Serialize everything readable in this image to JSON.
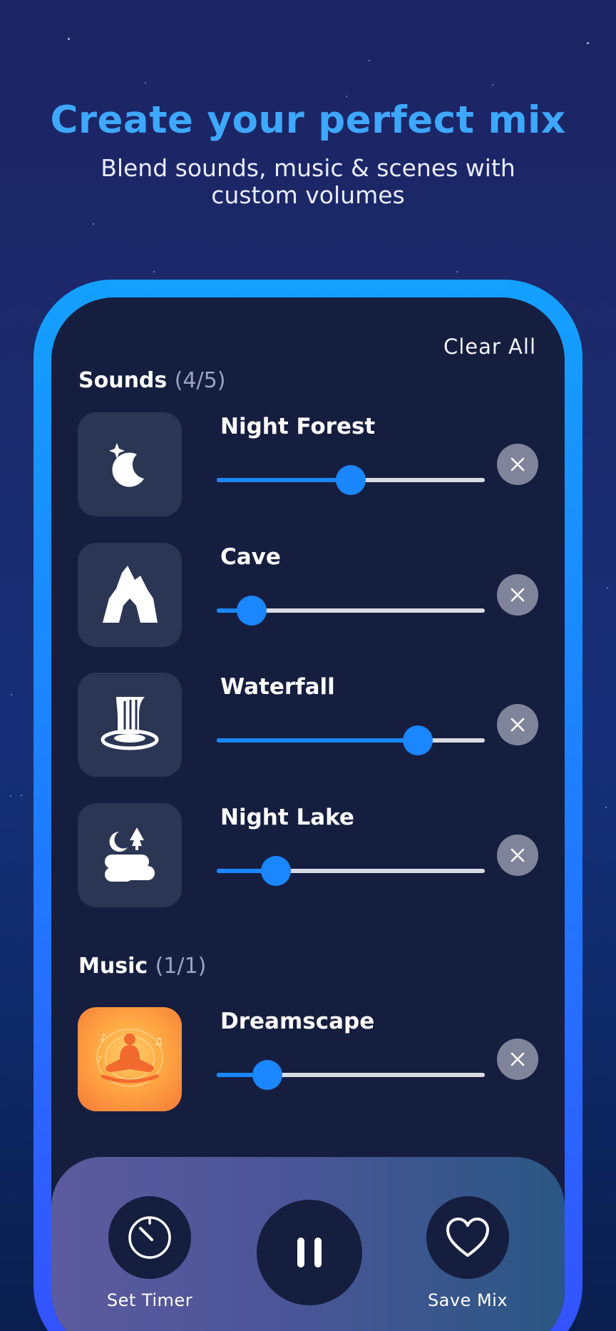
{
  "promo": {
    "headline": "Create your perfect mix",
    "subline": "Blend sounds, music & scenes with custom volumes"
  },
  "mixer": {
    "clear_all_label": "Clear All",
    "sounds_section": {
      "title": "Sounds",
      "count": "(4/5)"
    },
    "sounds": [
      {
        "name": "Night Forest",
        "icon": "moon-stars-icon",
        "volume": 0.5
      },
      {
        "name": "Cave",
        "icon": "cave-mountain-icon",
        "volume": 0.13
      },
      {
        "name": "Waterfall",
        "icon": "waterfall-icon",
        "volume": 0.75
      },
      {
        "name": "Night Lake",
        "icon": "night-lake-icon",
        "volume": 0.22
      }
    ],
    "music_section": {
      "title": "Music",
      "count": "(1/1)"
    },
    "music": [
      {
        "name": "Dreamscape",
        "icon": "meditation-icon",
        "volume": 0.19
      }
    ]
  },
  "controls": {
    "timer_label": "Set Timer",
    "save_label": "Save Mix",
    "playing": true
  },
  "colors": {
    "accent": "#1a86ff",
    "headline": "#3ea8ff",
    "screen_bg": "#161e3f",
    "tile_bg": "#2b3554",
    "remove_bg": "#80849a"
  }
}
